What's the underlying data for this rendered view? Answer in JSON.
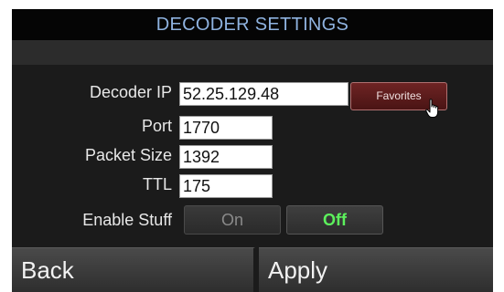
{
  "title": "DECODER SETTINGS",
  "fields": {
    "decoder_ip": {
      "label": "Decoder IP",
      "value": "52.25.129.48"
    },
    "port": {
      "label": "Port",
      "value": "1770"
    },
    "packet_size": {
      "label": "Packet Size",
      "value": "1392"
    },
    "ttl": {
      "label": "TTL",
      "value": "175"
    }
  },
  "favorites_label": "Favorites",
  "enable_stuff": {
    "label": "Enable Stuff",
    "on_label": "On",
    "off_label": "Off",
    "selected": "Off"
  },
  "footer": {
    "back_label": "Back",
    "apply_label": "Apply"
  },
  "colors": {
    "title_text": "#8fb3e0",
    "favorites_button": "#5a1c1c",
    "off_active_text": "#5cf05c"
  },
  "icons": {
    "cursor": "hand-pointer-icon"
  }
}
